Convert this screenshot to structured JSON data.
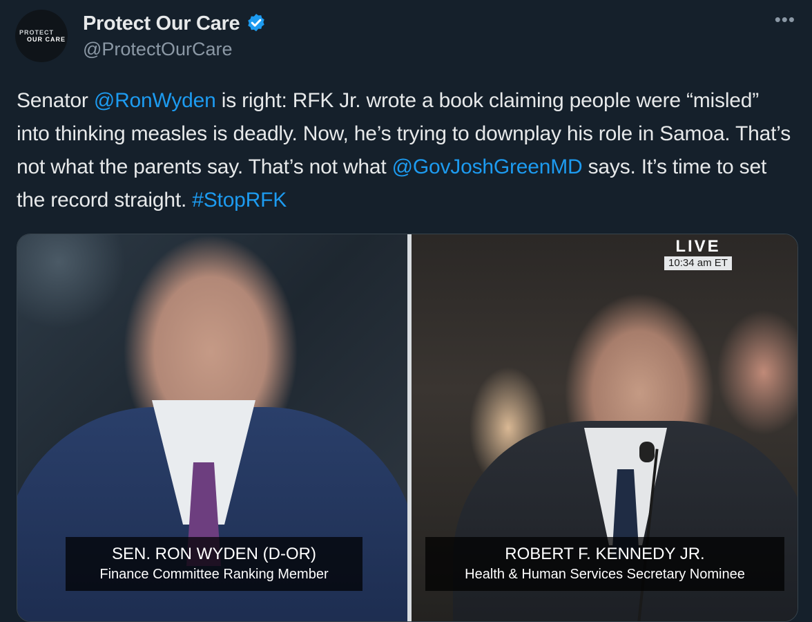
{
  "author": {
    "avatar_line1": "PROTECT",
    "avatar_line2": "OUR CARE",
    "display_name": "Protect Our Care",
    "handle": "@ProtectOurCare",
    "verified": true
  },
  "more_menu": "•••",
  "post": {
    "t1": "Senator ",
    "mention1": "@RonWyden",
    "t2": " is right: RFK Jr. wrote a book claiming people were “misled” into thinking measles is deadly. Now, he’s trying to downplay his role in Samoa. That’s not what the parents say. That’s not what ",
    "mention2": "@GovJoshGreenMD",
    "t3": " says. It’s time to set the record straight. ",
    "hashtag": "#StopRFK"
  },
  "media": {
    "left": {
      "name": "SEN. RON WYDEN (D-OR)",
      "title": "Finance Committee Ranking Member"
    },
    "right": {
      "name": "ROBERT F. KENNEDY JR.",
      "title": "Health & Human Services Secretary Nominee"
    },
    "live_label": "LIVE",
    "clock": "10:34 am ET"
  },
  "colors": {
    "background": "#15202b",
    "link": "#1d9bf0",
    "verified": "#1d9bf0"
  }
}
